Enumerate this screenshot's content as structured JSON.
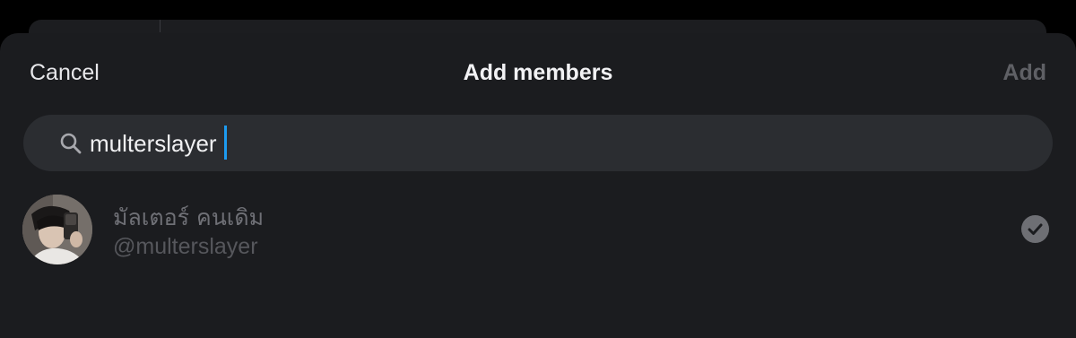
{
  "header": {
    "cancel_label": "Cancel",
    "title": "Add members",
    "add_label": "Add"
  },
  "search": {
    "value": "multerslayer",
    "placeholder": ""
  },
  "results": [
    {
      "display_name": "มัลเตอร์ คนเดิม",
      "handle": "@multerslayer",
      "selected": true
    }
  ],
  "colors": {
    "sheet_background": "#1b1c1f",
    "search_background": "#2b2d31",
    "caret": "#1d9bf0",
    "add_disabled": "#5f6065"
  },
  "icons": {
    "search": "search-icon",
    "selected": "check-circle-icon"
  }
}
